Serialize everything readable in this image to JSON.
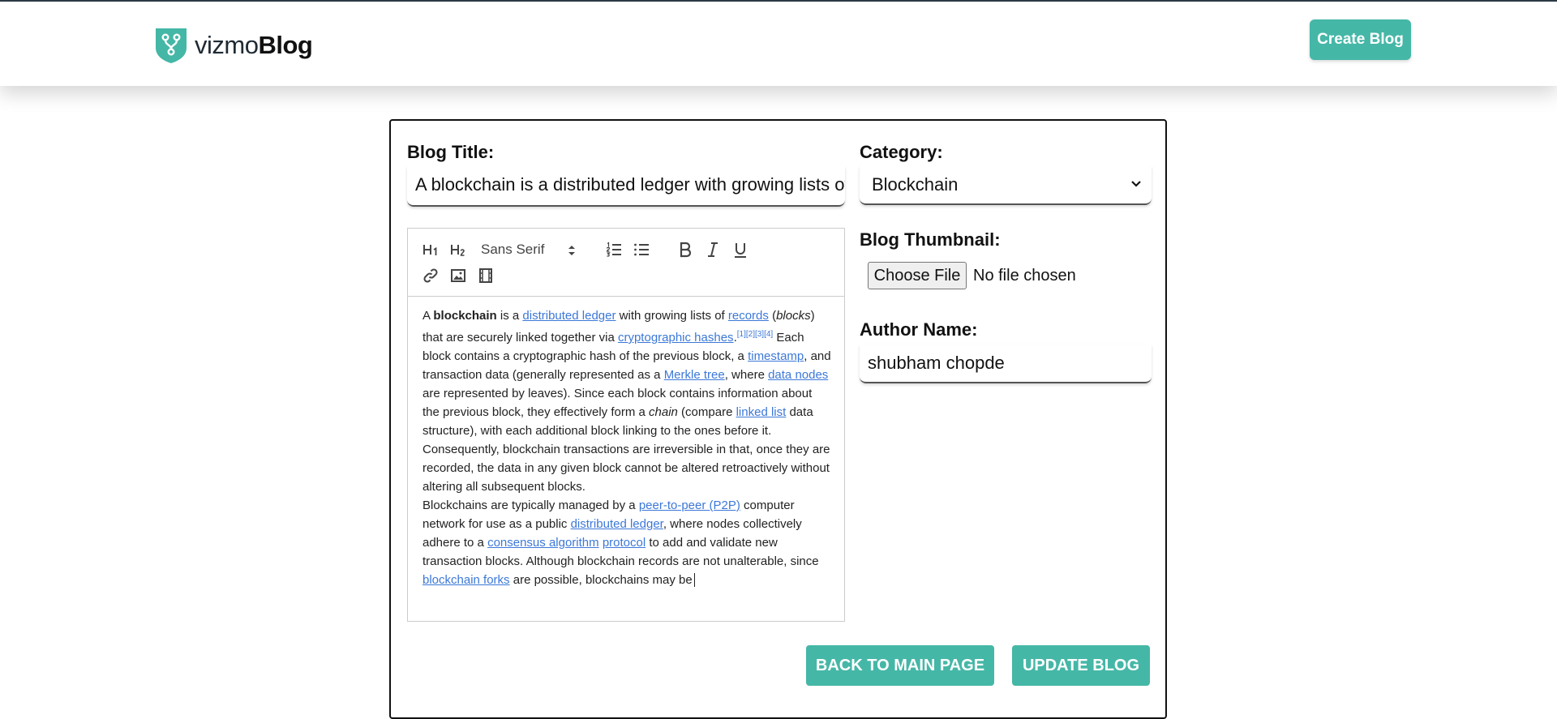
{
  "app": {
    "brand_part1": "vizmo",
    "brand_part2": "Blog",
    "create_button": "Create Blog"
  },
  "form": {
    "title_label": "Blog Title:",
    "title_value": "A blockchain is a distributed ledger with growing lists of records",
    "category_label": "Category:",
    "category_value": "Blockchain",
    "thumbnail_label": "Blog Thumbnail:",
    "file_button": "Choose File",
    "file_status": "No file chosen",
    "author_label": "Author Name:",
    "author_value": "shubham chopde",
    "back_button": "BACK TO MAIN PAGE",
    "update_button": "UPDATE BLOG"
  },
  "toolbar": {
    "h1": "H1",
    "h2": "H2",
    "font": "Sans Serif",
    "icons": [
      "heading-1-icon",
      "heading-2-icon",
      "ordered-list-icon",
      "bullet-list-icon",
      "bold-icon",
      "italic-icon",
      "underline-icon",
      "link-icon",
      "image-icon",
      "video-icon"
    ]
  },
  "editor": {
    "p1": {
      "t1": "A ",
      "b1": "blockchain",
      "t2": " is a ",
      "l1": "distributed ledger",
      "t3": " with growing lists of ",
      "l2": "records",
      "t4": " (",
      "i1": "blocks",
      "t5": ") that are securely linked together via ",
      "l3": "cryptographic hashes",
      "t6": ".",
      "s1": "[1][2][3][4]",
      "t7": " Each block contains a cryptographic hash of the previous block, a ",
      "l4": "timestamp",
      "t8": ", and transaction data (generally represented as a ",
      "l5": "Merkle tree",
      "t9": ", where ",
      "l6": "data nodes",
      "t10": " are represented by leaves). Since each block contains information about the previous block, they effectively form a ",
      "i2": "chain",
      "t11": " (compare ",
      "l7": "linked list",
      "t12": " data structure), with each additional block linking to the ones before it. Consequently, blockchain transactions are irreversible in that, once they are recorded, the data in any given block cannot be altered retroactively without altering all subsequent blocks."
    },
    "p2": {
      "t1": "Blockchains are typically managed by a ",
      "l1": "peer-to-peer (P2P)",
      "t2": " computer network for use as a public ",
      "l2": "distributed ledger",
      "t3": ", where nodes collectively adhere to a ",
      "l3": "consensus algorithm",
      "t4": " ",
      "l4": "protocol",
      "t5": " to add and validate new transaction blocks. Although blockchain records are not unalterable, since ",
      "l5": "blockchain forks",
      "t6": " are possible, blockchains may be"
    }
  },
  "colors": {
    "accent": "#45b7a7",
    "link": "#3c78d8",
    "topline": "#2d3b46"
  }
}
